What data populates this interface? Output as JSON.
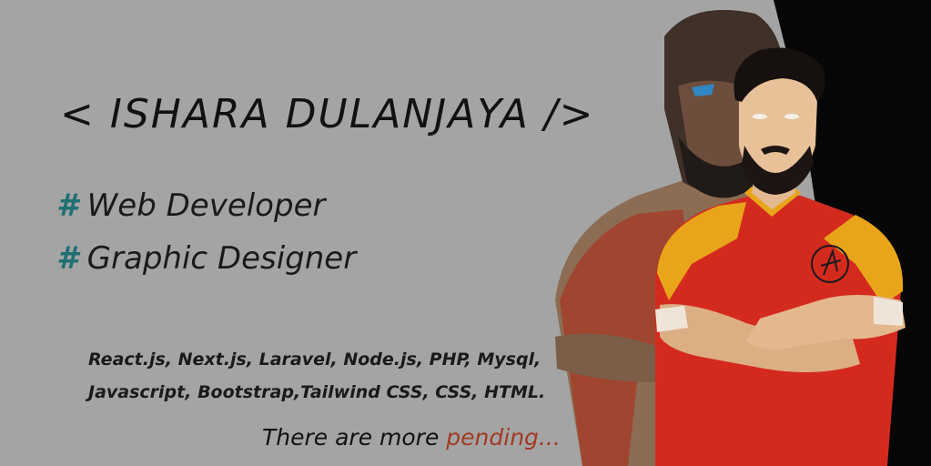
{
  "header": {
    "title": "< ISHARA DULANJAYA />"
  },
  "roles": [
    {
      "hash": "#",
      "label": "Web Developer"
    },
    {
      "hash": "#",
      "label": "Graphic Designer"
    }
  ],
  "skills": {
    "line1": "React.js, Next.js, Laravel, Node.js, PHP, Mysql,",
    "line2": "Javascript, Bootstrap,Tailwind CSS, CSS, HTML."
  },
  "footer": {
    "prefix": "There are more ",
    "highlight": "pending..."
  },
  "colors": {
    "background": "#a4a4a4",
    "dark_panel": "#060606",
    "hash_accent": "#1f6f73",
    "pending_accent": "#a23a22",
    "shirt_red": "#d42a1e",
    "shirt_yellow": "#e8a51a"
  }
}
